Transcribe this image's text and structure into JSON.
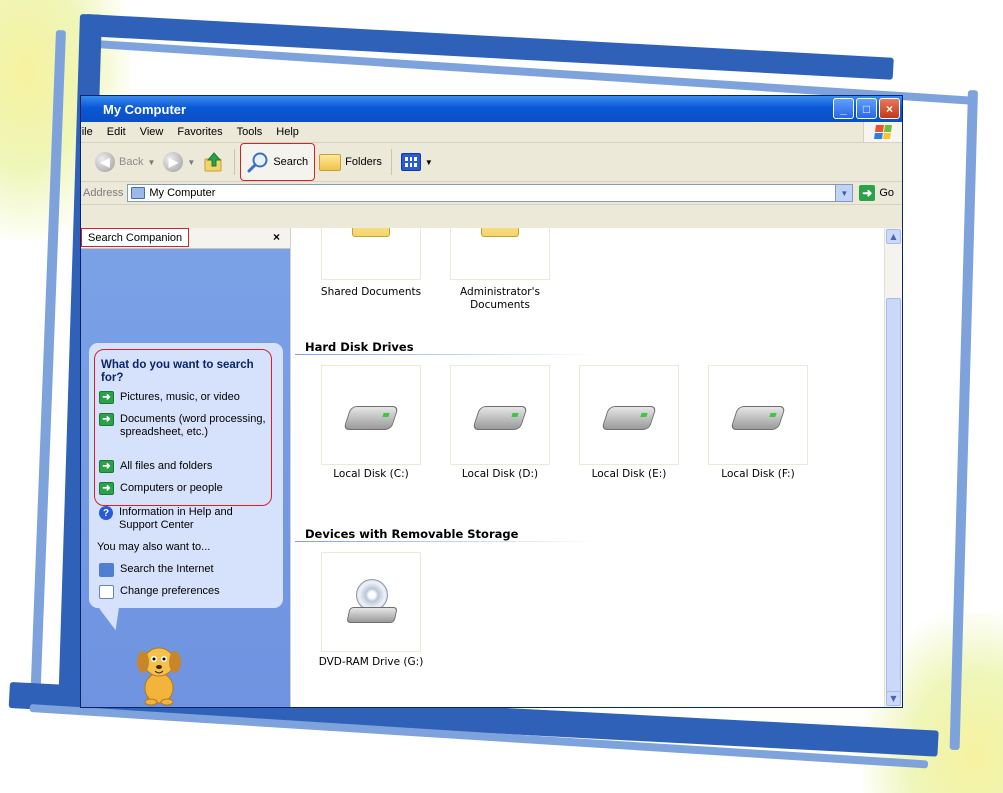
{
  "window": {
    "title": "My Computer",
    "controls": [
      "_",
      "□",
      "×"
    ]
  },
  "menu": [
    "File",
    "Edit",
    "View",
    "Favorites",
    "Tools",
    "Help"
  ],
  "toolbar": {
    "back": "Back",
    "search": "Search",
    "folders": "Folders"
  },
  "address": {
    "label": "Address",
    "value": "My Computer",
    "go": "Go"
  },
  "search_pane": {
    "title": "Search Companion",
    "close": "×",
    "question": "What do you want to search for?",
    "options": [
      "Pictures, music, or video",
      "Documents (word processing, spreadsheet, etc.)",
      "All files and folders",
      "Computers or people"
    ],
    "help": "Information in Help and Support Center",
    "also": "You may also want to...",
    "links": [
      "Search the Internet",
      "Change preferences"
    ]
  },
  "content": {
    "folders": [
      "Shared Documents",
      "Administrator's Documents"
    ],
    "hard_disks_heading": "Hard Disk Drives",
    "disks": [
      "Local Disk (C:)",
      "Local Disk (D:)",
      "Local Disk (E:)",
      "Local Disk (F:)"
    ],
    "removable_heading": "Devices with Removable Storage",
    "removable": [
      "DVD-RAM Drive (G:)"
    ]
  },
  "colors": {
    "title_blue": "#0a58d6",
    "pane_blue": "#7ba2e7",
    "highlight_red": "#d2232a",
    "go_green": "#2ba24a"
  }
}
